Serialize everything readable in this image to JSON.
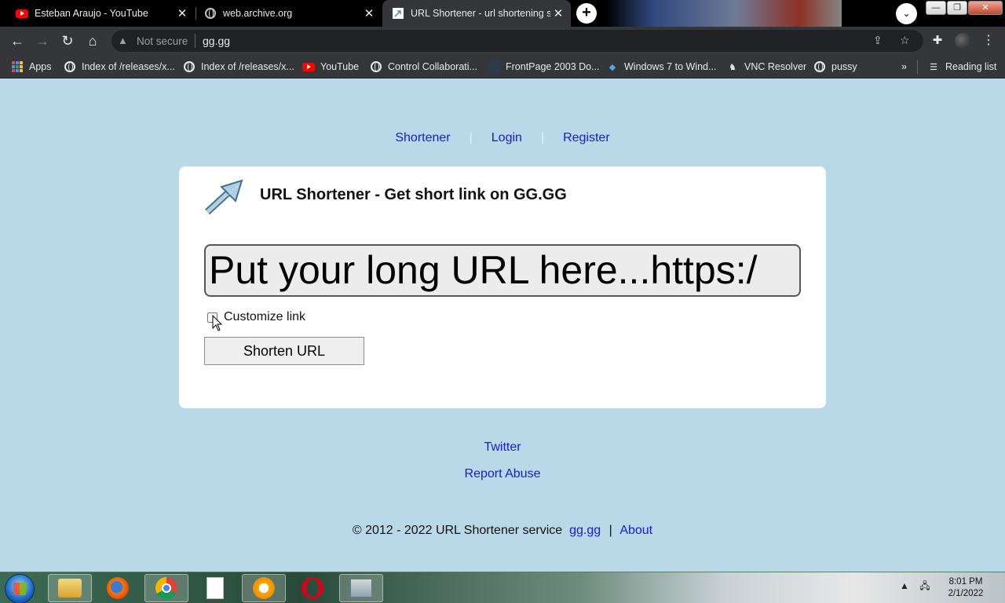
{
  "browser": {
    "tabs": [
      {
        "title": "Esteban Araujo - YouTube",
        "icon": "youtube-icon"
      },
      {
        "title": "web.archive.org",
        "icon": "globe-icon"
      },
      {
        "title": "URL Shortener - url shortening se",
        "icon": "arrow-icon"
      }
    ],
    "security_label": "Not secure",
    "url": "gg.gg",
    "bookmarks": [
      {
        "label": "Apps",
        "icon": "apps-grid-icon"
      },
      {
        "label": "Index of /releases/x...",
        "icon": "globe-icon"
      },
      {
        "label": "Index of /releases/x...",
        "icon": "globe-icon"
      },
      {
        "label": "YouTube",
        "icon": "youtube-icon"
      },
      {
        "label": "Control Collaborati...",
        "icon": "globe-icon"
      },
      {
        "label": "FrontPage 2003 Do...",
        "icon": "frontpage-icon"
      },
      {
        "label": "Windows 7 to Wind...",
        "icon": "windows-icon"
      },
      {
        "label": "VNC Resolver",
        "icon": "vnc-icon"
      },
      {
        "label": "pussy",
        "icon": "globe-icon"
      }
    ],
    "overflow_label": "»",
    "reading_list_label": "Reading list"
  },
  "page": {
    "nav": {
      "shortener": "Shortener",
      "login": "Login",
      "register": "Register",
      "separator": "|"
    },
    "title": "URL Shortener - Get short link on GG.GG",
    "url_input": {
      "placeholder": "Put your long URL here...",
      "value": "Put your long URL here...https:/"
    },
    "customize_label": "Customize link",
    "customize_checked": false,
    "shorten_button": "Shorten URL",
    "footer_links": {
      "twitter": "Twitter",
      "report": "Report Abuse"
    },
    "copyright": "© 2012 - 2022 URL Shortener service",
    "copyright_link": "gg.gg",
    "copyright_separator": "|",
    "about_link": "About"
  },
  "taskbar": {
    "apps": [
      "explorer-icon",
      "firefox-icon",
      "chrome-icon",
      "document-icon",
      "avast-icon",
      "opera-icon",
      "task-manager-icon"
    ],
    "time": "8:01 PM",
    "date": "2/1/2022"
  },
  "colors": {
    "page_background": "#b9d9e8",
    "link": "#1a1ad6",
    "card": "#ffffff"
  }
}
